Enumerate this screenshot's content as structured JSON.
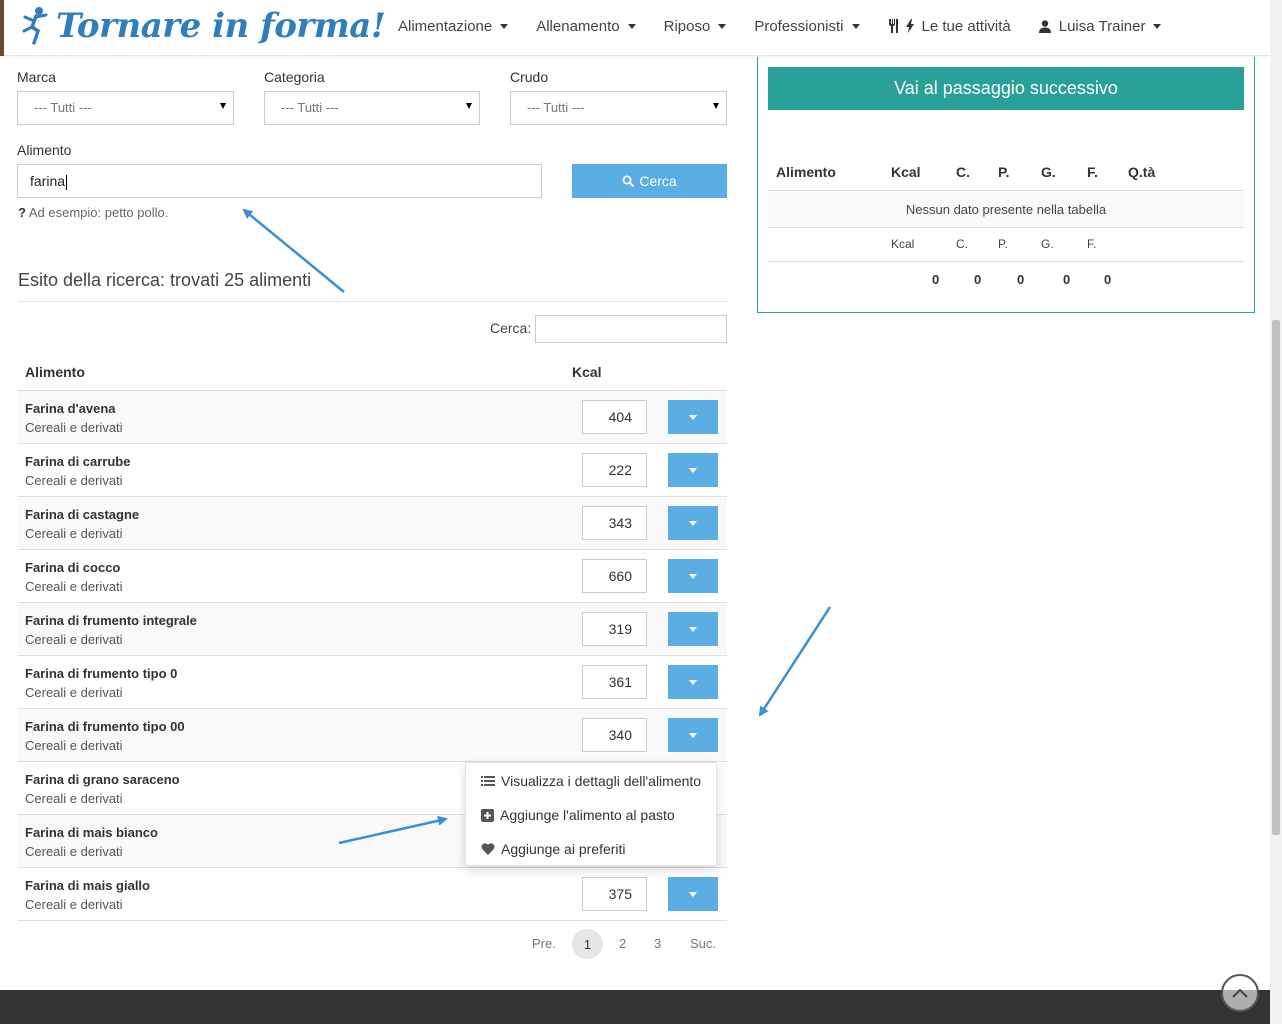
{
  "brand": {
    "name": "Tornare in forma!"
  },
  "nav": {
    "items": [
      {
        "label": "Alimentazione"
      },
      {
        "label": "Allenamento"
      },
      {
        "label": "Riposo"
      },
      {
        "label": "Professionisti"
      },
      {
        "label": "Le tue attività"
      },
      {
        "label": "Luisa Trainer"
      }
    ]
  },
  "filters": {
    "marca_label": "Marca",
    "categoria_label": "Categoria",
    "crudo_label": "Crudo",
    "marca_value": "--- Tutti ---",
    "categoria_value": "--- Tutti ---",
    "crudo_value": "--- Tutti ---",
    "alimento_label": "Alimento",
    "alimento_value": "farina",
    "search_button": "Cerca",
    "hint_text": "Ad esempio: petto pollo."
  },
  "results": {
    "title": "Esito della ricerca: trovati 25 alimenti",
    "filter_label": "Cerca:",
    "filter_value": "",
    "columns": {
      "food": "Alimento",
      "kcal": "Kcal"
    },
    "rows": [
      {
        "name": "Farina d'avena",
        "category": "Cereali e derivati",
        "kcal": "404"
      },
      {
        "name": "Farina di carrube",
        "category": "Cereali e derivati",
        "kcal": "222"
      },
      {
        "name": "Farina di castagne",
        "category": "Cereali e derivati",
        "kcal": "343"
      },
      {
        "name": "Farina di cocco",
        "category": "Cereali e derivati",
        "kcal": "660"
      },
      {
        "name": "Farina di frumento integrale",
        "category": "Cereali e derivati",
        "kcal": "319"
      },
      {
        "name": "Farina di frumento tipo 0",
        "category": "Cereali e derivati",
        "kcal": "361"
      },
      {
        "name": "Farina di frumento tipo 00",
        "category": "Cereali e derivati",
        "kcal": "340"
      },
      {
        "name": "Farina di grano saraceno",
        "category": "Cereali e derivati",
        "kcal": ""
      },
      {
        "name": "Farina di mais bianco",
        "category": "Cereali e derivati",
        "kcal": ""
      },
      {
        "name": "Farina di mais giallo",
        "category": "Cereali e derivati",
        "kcal": "375"
      }
    ],
    "menu": [
      {
        "label": "Visualizza i dettagli dell'alimento",
        "icon": "list-icon"
      },
      {
        "label": "Aggiunge l'alimento al pasto",
        "icon": "plus-square-icon"
      },
      {
        "label": "Aggiunge ai preferiti",
        "icon": "heart-icon"
      }
    ],
    "pagination": {
      "prev": "Pre.",
      "pages": [
        "1",
        "2",
        "3"
      ],
      "current": "1",
      "next": "Suc."
    }
  },
  "meal_panel": {
    "next_button": "Vai al passaggio successivo",
    "columns": [
      "Alimento",
      "Kcal",
      "C.",
      "P.",
      "G.",
      "F.",
      "Q.tà"
    ],
    "empty_text": "Nessun dato presente nella tabella",
    "sub_columns": [
      "Kcal",
      "C.",
      "P.",
      "G.",
      "F."
    ],
    "totals": [
      "0",
      "0",
      "0",
      "0",
      "0"
    ]
  },
  "colors": {
    "primary": "#5aaee3",
    "teal": "#2aa198",
    "footer": "#333333",
    "annotation_arrow": "#3b8fd4"
  }
}
